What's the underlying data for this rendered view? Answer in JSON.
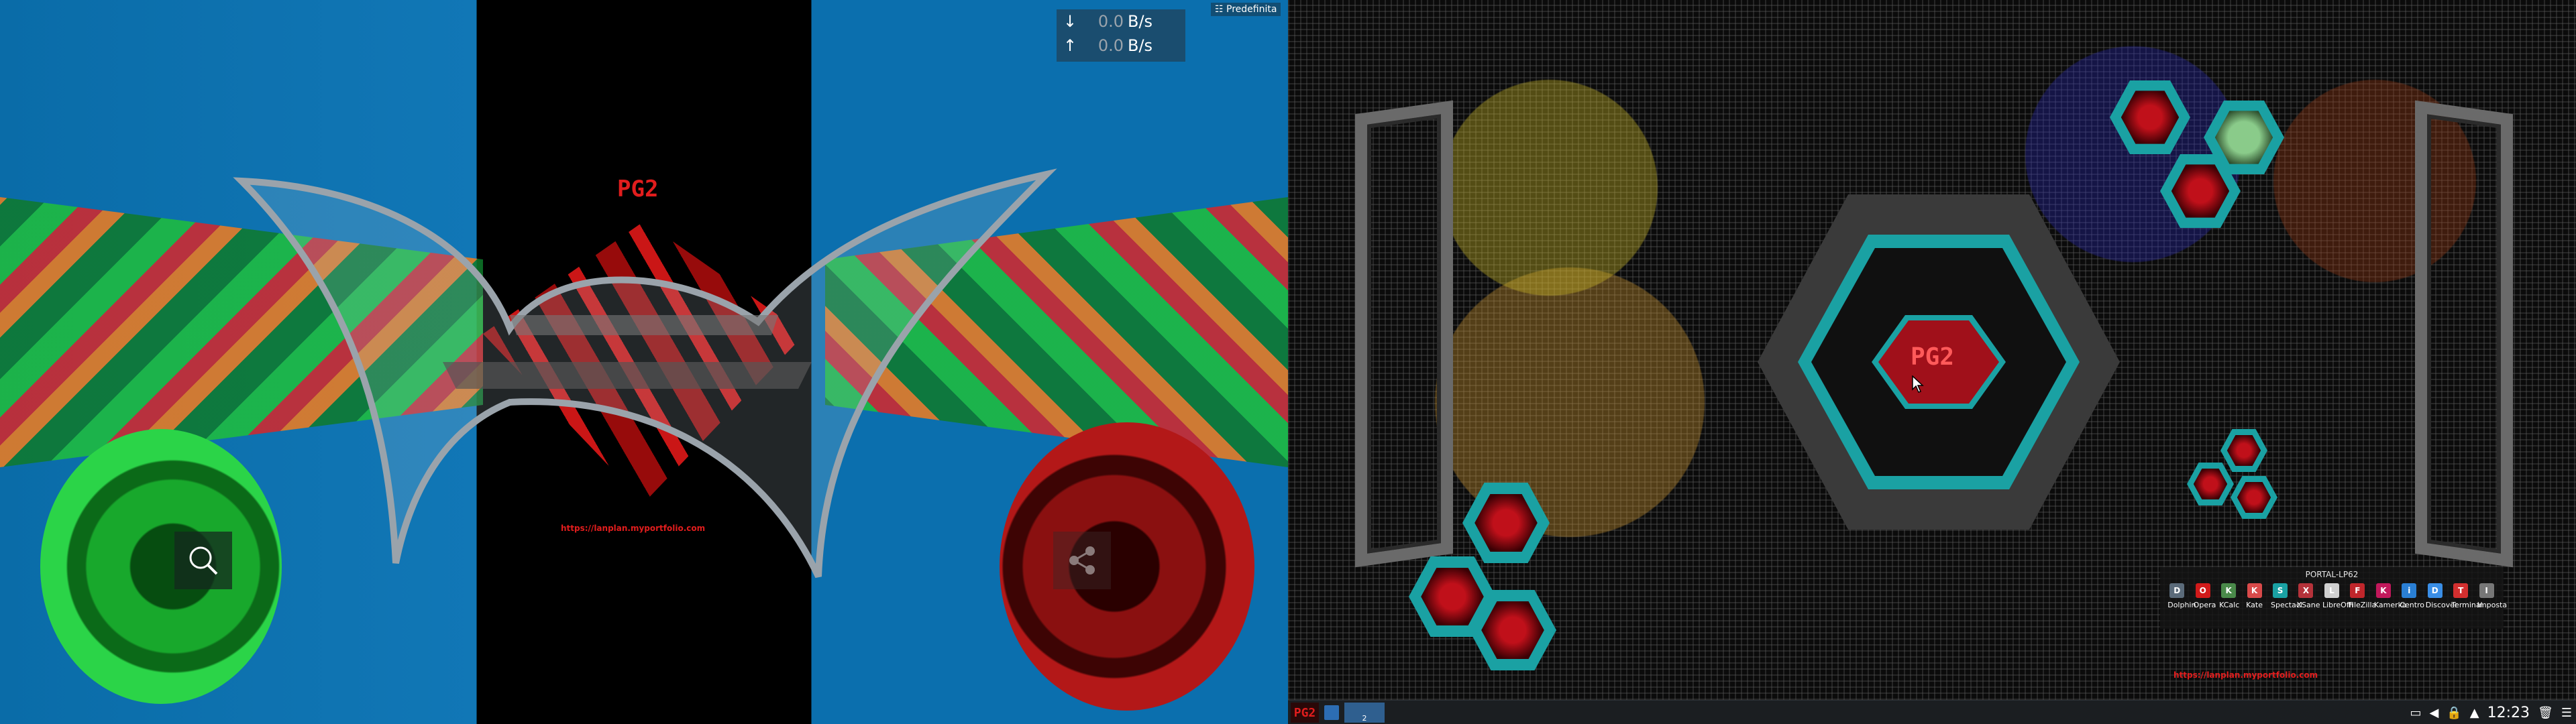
{
  "left_screen": {
    "logo_text": "PG2",
    "url_text": "https://lanplan.myportfolio.com",
    "search_icon": "search-icon",
    "share_icon": "share-icon"
  },
  "net_widget": {
    "download_arrow": "↓",
    "download_value": "0.0",
    "download_unit": "B/s",
    "upload_arrow": "↑",
    "upload_value": "0.0",
    "upload_unit": "B/s"
  },
  "preset_label": "Predefinita",
  "right_screen": {
    "logo_text": "PG2",
    "url_text": "https://lanplan.myportfolio.com"
  },
  "dock": {
    "title": "PORTAL-LP62",
    "items": [
      {
        "label": "Dolphin",
        "icon": "D",
        "color": "#5b6b7a"
      },
      {
        "label": "Opera",
        "icon": "O",
        "color": "#d11a1a"
      },
      {
        "label": "KCalc",
        "icon": "K",
        "color": "#4a8a4a"
      },
      {
        "label": "Kate",
        "icon": "K",
        "color": "#d94a4a"
      },
      {
        "label": "Spectacl",
        "icon": "S",
        "color": "#1aa1a3"
      },
      {
        "label": "XSane",
        "icon": "X",
        "color": "#b5323a"
      },
      {
        "label": "LibreOffi",
        "icon": "L",
        "color": "#d0d0d0"
      },
      {
        "label": "FileZilla",
        "icon": "F",
        "color": "#c0262b"
      },
      {
        "label": "Kamerka",
        "icon": "K",
        "color": "#c2185b"
      },
      {
        "label": "Centro",
        "icon": "i",
        "color": "#2a7fd4"
      },
      {
        "label": "Discover",
        "icon": "D",
        "color": "#3a8ee6"
      },
      {
        "label": "Terminal",
        "icon": "T",
        "color": "#d32f2f"
      },
      {
        "label": "Imposta",
        "icon": "I",
        "color": "#777777"
      }
    ]
  },
  "taskbar": {
    "start_label": "PG2",
    "pager_label": "2",
    "clock": "12:23"
  }
}
